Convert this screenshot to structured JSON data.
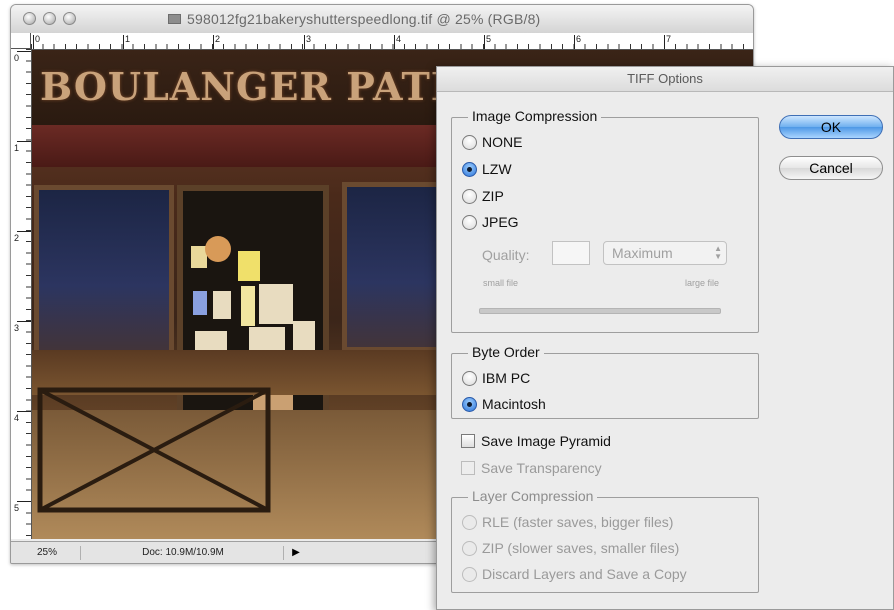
{
  "document_window": {
    "title": "598012fg21bakeryshutterspeedlong.tif @ 25% (RGB/8)",
    "ruler_top_labels": [
      "0",
      "1",
      "2",
      "3",
      "4",
      "5",
      "6",
      "7"
    ],
    "ruler_left_labels": [
      "0",
      "1",
      "2",
      "3",
      "4",
      "5"
    ],
    "sign_text": "BOULANGER PATIS",
    "status": {
      "zoom": "25%",
      "doc_info": "Doc: 10.9M/10.9M",
      "menu_arrow": "▶"
    }
  },
  "dialog": {
    "title": "TIFF Options",
    "image_compression": {
      "label": "Image Compression",
      "options": [
        "NONE",
        "LZW",
        "ZIP",
        "JPEG"
      ],
      "selected": "LZW"
    },
    "quality": {
      "label": "Quality:",
      "value": "",
      "select_value": "Maximum",
      "small_label": "small file",
      "large_label": "large file"
    },
    "byte_order": {
      "label": "Byte Order",
      "options": [
        "IBM PC",
        "Macintosh"
      ],
      "selected": "Macintosh"
    },
    "save_image_pyramid": "Save Image Pyramid",
    "save_transparency": "Save Transparency",
    "layer_compression": {
      "label": "Layer Compression",
      "options": [
        "RLE (faster saves, bigger files)",
        "ZIP (slower saves, smaller files)",
        "Discard Layers and Save a Copy"
      ]
    },
    "ok_label": "OK",
    "cancel_label": "Cancel"
  }
}
